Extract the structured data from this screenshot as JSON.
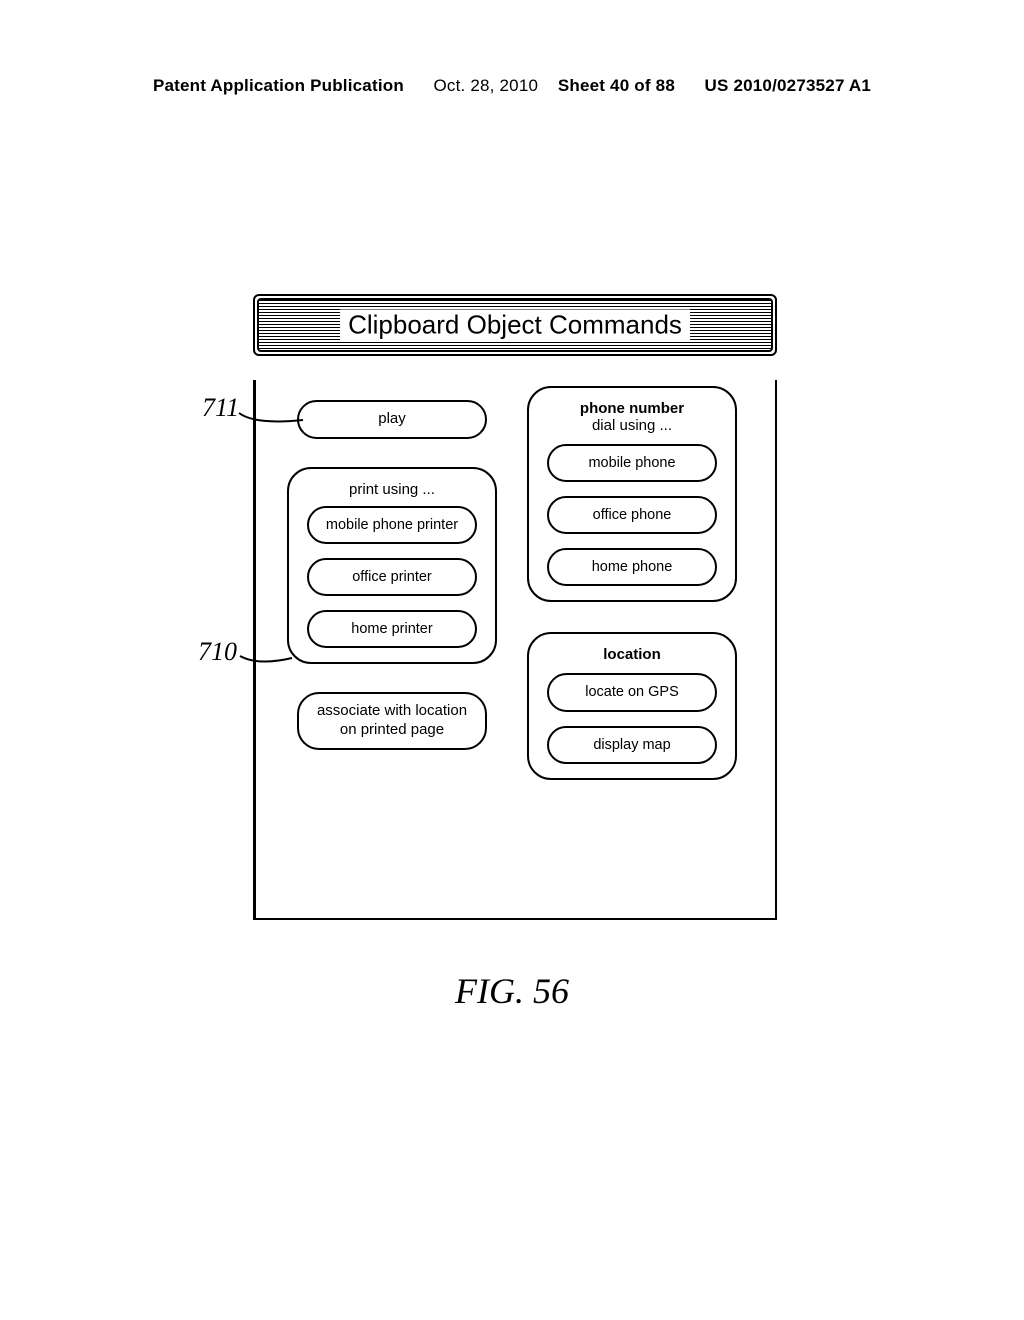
{
  "header": {
    "pub_label": "Patent Application Publication",
    "date": "Oct. 28, 2010",
    "sheet": "Sheet 40 of 88",
    "pub_number": "US 2010/0273527 A1"
  },
  "title": "Clipboard Object Commands",
  "refs": {
    "r711": "711",
    "r710": "710"
  },
  "left": {
    "play": "play",
    "print_group_label": "print using ...",
    "print_options": {
      "mobile": "mobile phone printer",
      "office": "office printer",
      "home": "home printer"
    },
    "assoc": "associate with location on printed page"
  },
  "right": {
    "phone_group_title": "phone number",
    "phone_group_sub": "dial using ...",
    "phone_options": {
      "mobile": "mobile phone",
      "office": "office phone",
      "home": "home phone"
    },
    "location_group_title": "location",
    "location_options": {
      "gps": "locate on GPS",
      "map": "display map"
    }
  },
  "figure_caption": "FIG. 56"
}
